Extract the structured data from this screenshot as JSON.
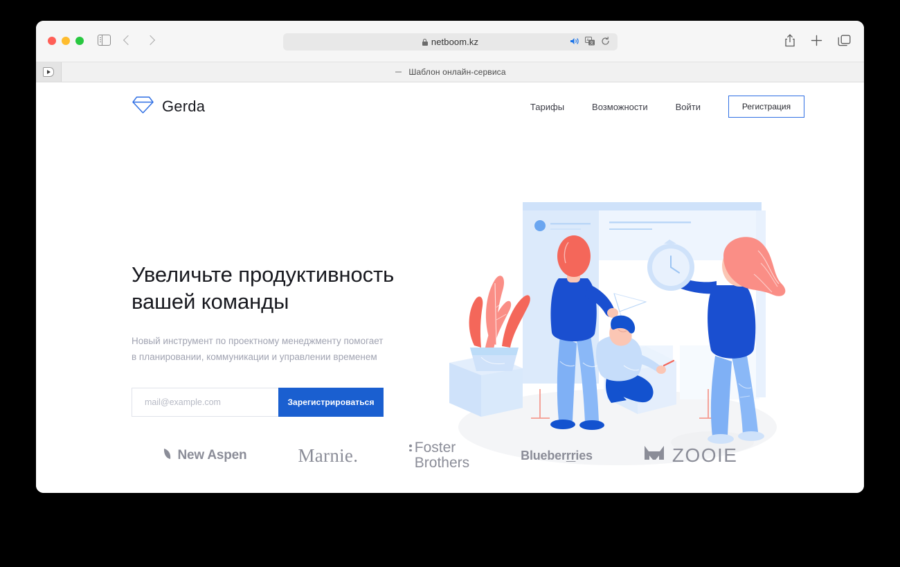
{
  "browser": {
    "traffic_lights": [
      "close",
      "minimize",
      "maximize"
    ],
    "url": "netboom.kz",
    "tab_title": "Шаблон онлайн-сервиса",
    "icons": {
      "sidebar": "sidebar-icon",
      "back": "chevron-left-icon",
      "forward": "chevron-right-icon",
      "shield": "shield-icon",
      "lock": "lock-icon",
      "speaker": "speaker-icon",
      "translate": "translate-icon",
      "reload": "reload-icon",
      "share": "share-icon",
      "new_tab": "plus-icon",
      "tab_overview": "tab-overview-icon",
      "media_play": "play-icon"
    }
  },
  "site": {
    "brand": {
      "name": "Gerda",
      "logo_icon": "diamond-icon",
      "logo_color": "#2f6fe4"
    },
    "nav": {
      "links": [
        {
          "label": "Тарифы"
        },
        {
          "label": "Возможности"
        },
        {
          "label": "Войти"
        }
      ],
      "register_button": "Регистрация"
    },
    "hero": {
      "title": "Увеличьте продуктивность вашей команды",
      "subtitle": "Новый инструмент по проектному менеджменту помогает в планировании, коммуникации и управлении временем",
      "email_placeholder": "mail@example.com",
      "email_value": "",
      "cta_label": "Зарегистрироваться",
      "cta_color": "#1a5fd0",
      "illustration": "team-productivity-illustration"
    },
    "partners": [
      {
        "name": "New Aspen",
        "icon": "aspen-leaf-icon"
      },
      {
        "name": "Marnie."
      },
      {
        "name_line1": "Foster",
        "name_line2": "Brothers",
        "icon": "two-dots-icon"
      },
      {
        "name_prefix": "Blueber",
        "name_underlined": "rr",
        "name_suffix": "ies"
      },
      {
        "name": "ZOOIE",
        "icon": "cat-icon"
      }
    ]
  },
  "colors": {
    "accent_blue": "#1a5fd0",
    "brand_blue": "#2f6fe4",
    "illustration_red": "#f4675a",
    "illustration_pink": "#fa8e86",
    "text_dark": "#18191f",
    "text_muted": "#a0a3b1",
    "logo_gray": "#8b8d98"
  }
}
